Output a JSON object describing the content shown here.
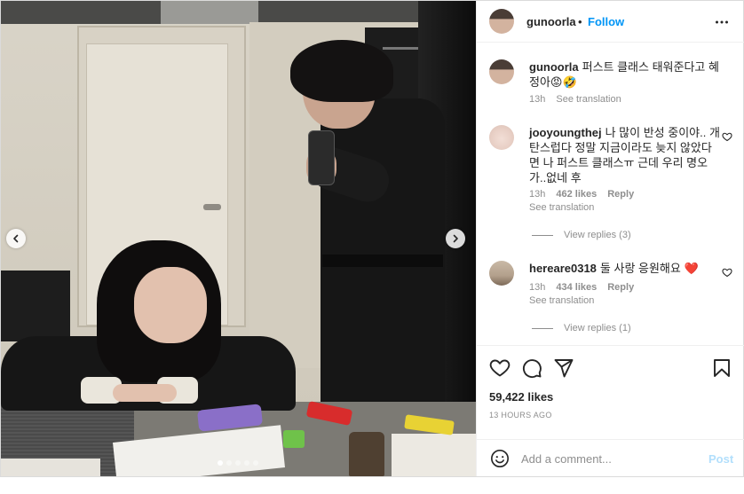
{
  "header": {
    "username": "gunoorla",
    "separator": "•",
    "follow_label": "Follow",
    "more_icon": "more-horizontal-icon"
  },
  "caption": {
    "username": "gunoorla",
    "text": "퍼스트 클래스 태워준다고 혜정아😡🤣",
    "time": "13h",
    "see_translation": "See translation"
  },
  "comments": [
    {
      "username": "jooyoungthej",
      "text": "나 많이 반성 중이야.. 개탄스럽다 정말 지금이라도 늦지 않았다면 나 퍼스트 클래스ㅠ 근데 우리 명오가..없네 후",
      "time": "13h",
      "likes": "462 likes",
      "reply": "Reply",
      "see_translation": "See translation",
      "view_replies": "View replies (3)"
    },
    {
      "username": "hereare0318",
      "text": "둘 사랑 응원해요 ❤️",
      "time": "13h",
      "likes": "434 likes",
      "reply": "Reply",
      "see_translation": "See translation",
      "view_replies": "View replies (1)"
    }
  ],
  "carousel": {
    "total": 5,
    "active_index": 0,
    "prev_icon": "chevron-left-icon",
    "next_icon": "chevron-right-icon"
  },
  "actions": {
    "icons": [
      "heart-icon",
      "comment-icon",
      "share-icon",
      "bookmark-icon"
    ],
    "likes": "59,422 likes",
    "posted": "13 HOURS AGO"
  },
  "add_comment": {
    "placeholder": "Add a comment...",
    "post_label": "Post",
    "emoji_icon": "emoji-icon"
  },
  "colors": {
    "accent": "#0095f6",
    "post_disabled": "#b2dffc",
    "muted_text": "#8e8e8e",
    "divider": "#efefef"
  }
}
